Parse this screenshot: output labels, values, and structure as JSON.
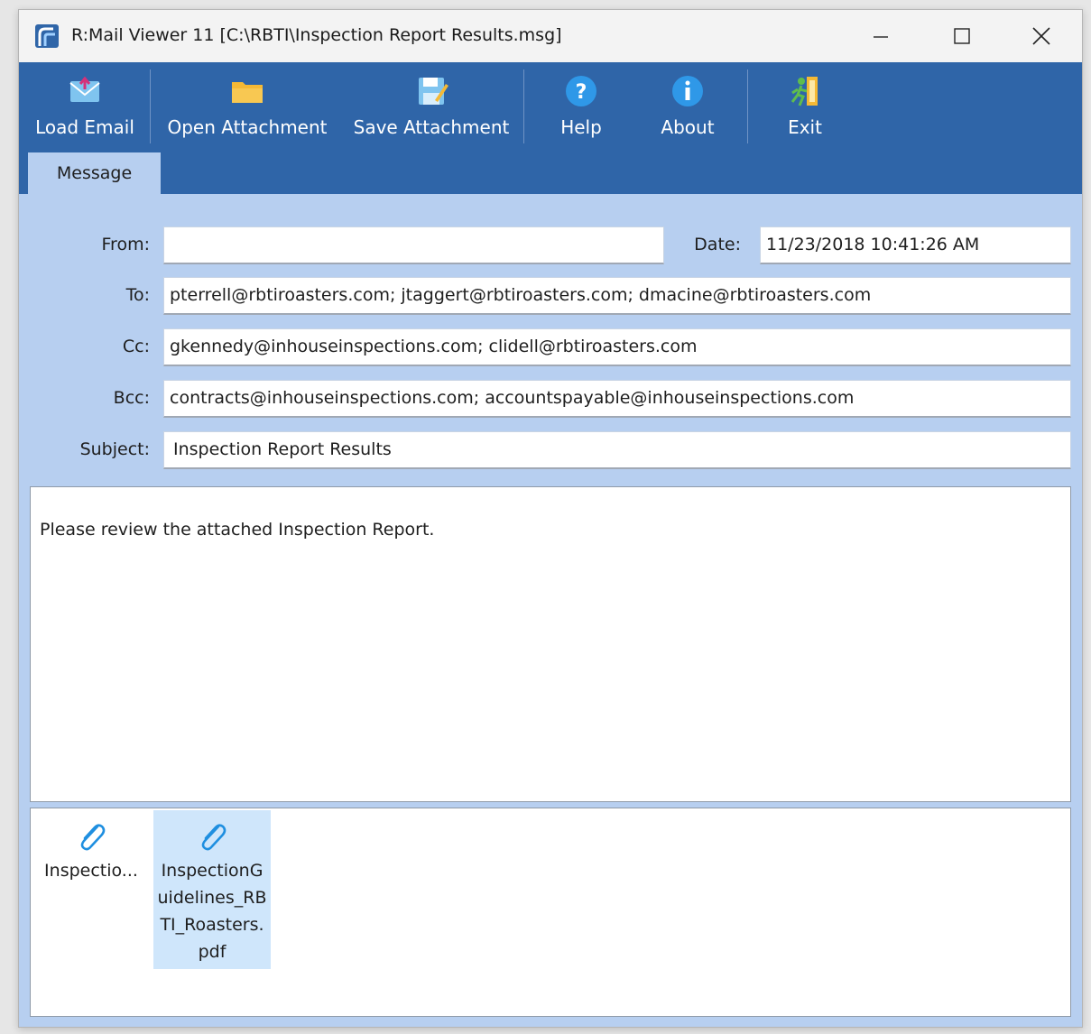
{
  "window": {
    "title": "R:Mail Viewer 11 [C:\\RBTI\\Inspection Report Results.msg]",
    "controls": {
      "minimize": "minimize-icon",
      "maximize": "maximize-icon",
      "close": "close-icon"
    }
  },
  "toolbar": {
    "buttons": [
      {
        "label": "Load Email",
        "icon": "envelope-icon"
      },
      {
        "label": "Open Attachment",
        "icon": "folder-icon"
      },
      {
        "label": "Save Attachment",
        "icon": "save-icon"
      },
      {
        "label": "Help",
        "icon": "help-icon"
      },
      {
        "label": "About",
        "icon": "info-icon"
      },
      {
        "label": "Exit",
        "icon": "exit-icon"
      }
    ]
  },
  "tabs": [
    {
      "label": "Message",
      "active": true
    }
  ],
  "form": {
    "from_label": "From:",
    "from_value": "",
    "date_label": "Date:",
    "date_value": "11/23/2018 10:41:26 AM",
    "to_label": "To:",
    "to_value": "pterrell@rbtiroasters.com; jtaggert@rbtiroasters.com; dmacine@rbtiroasters.com",
    "cc_label": "Cc:",
    "cc_value": "gkennedy@inhouseinspections.com; clidell@rbtiroasters.com",
    "bcc_label": "Bcc:",
    "bcc_value": "contracts@inhouseinspections.com; accountspayable@inhouseinspections.com",
    "subject_label": "Subject:",
    "subject_value": "Inspection Report Results"
  },
  "message_body": "Please review the attached Inspection Report.",
  "attachments": [
    {
      "name": "Inspectio...",
      "icon": "paperclip-icon",
      "selected": false
    },
    {
      "name": "InspectionGuidelines_RBTI_Roasters.pdf",
      "icon": "paperclip-icon",
      "selected": true
    }
  ],
  "colors": {
    "toolbar_bg": "#2f65a8",
    "window_bg": "#b7cff0",
    "selection": "#cfe6fb",
    "icon_blue": "#1f8fe0",
    "folder_yellow": "#f5b935"
  }
}
